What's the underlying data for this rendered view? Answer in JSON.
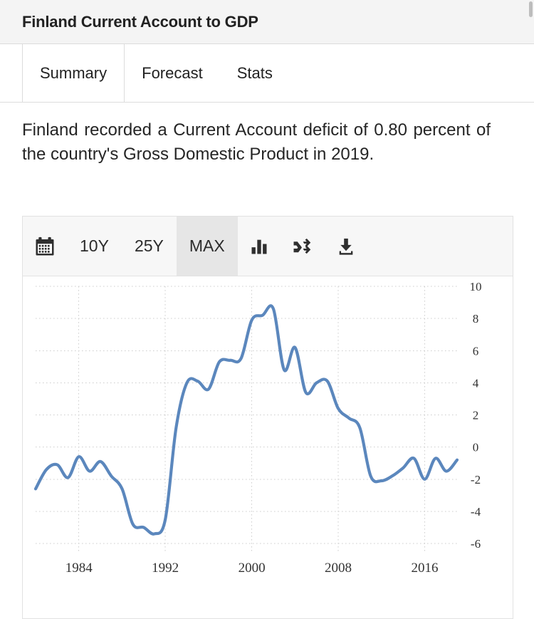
{
  "header": {
    "title": "Finland Current Account to GDP"
  },
  "tabs": [
    {
      "label": "Summary",
      "active": true
    },
    {
      "label": "Forecast",
      "active": false
    },
    {
      "label": "Stats",
      "active": false
    }
  ],
  "description": "Finland recorded a Current Account deficit of 0.80 percent of the country's Gross Domestic Product in 2019.",
  "toolbar": {
    "calendar_icon": "calendar-icon",
    "range_10y": "10Y",
    "range_25y": "25Y",
    "range_max": "MAX",
    "selected_range": "MAX",
    "column_chart_icon": "bar-chart-icon",
    "compare_icon": "shuffle-icon",
    "download_icon": "download-icon"
  },
  "colors": {
    "line": "#5b87bd",
    "grid": "#cccccc",
    "header_bg": "#f4f4f4",
    "toolbar_bg": "#f7f7f7",
    "toolbar_selected_bg": "#e6e6e6",
    "text": "#252525"
  },
  "chart_data": {
    "type": "line",
    "title": "Finland Current Account to GDP",
    "xlabel": "",
    "ylabel": "percent of GDP",
    "xlim": [
      1980,
      2019
    ],
    "ylim": [
      -6,
      10
    ],
    "ytick_values": [
      10,
      8,
      6,
      4,
      2,
      0,
      -2,
      -4,
      -6
    ],
    "xtick_values": [
      1984,
      1992,
      2000,
      2008,
      2016
    ],
    "grid": true,
    "legend": "none",
    "series": [
      {
        "name": "Current Account to GDP",
        "color": "#5b87bd",
        "x": [
          1980,
          1981,
          1982,
          1983,
          1984,
          1985,
          1986,
          1987,
          1988,
          1989,
          1990,
          1991,
          1992,
          1993,
          1994,
          1995,
          1996,
          1997,
          1998,
          1999,
          2000,
          2001,
          2002,
          2003,
          2004,
          2005,
          2006,
          2007,
          2008,
          2009,
          2010,
          2011,
          2012,
          2013,
          2014,
          2015,
          2016,
          2017,
          2018,
          2019
        ],
        "values": [
          -2.6,
          -1.4,
          -1.1,
          -1.9,
          -0.6,
          -1.5,
          -0.9,
          -1.8,
          -2.6,
          -4.8,
          -5.0,
          -5.4,
          -4.5,
          1.2,
          4.0,
          4.1,
          3.6,
          5.3,
          5.4,
          5.5,
          7.9,
          8.2,
          8.6,
          4.8,
          6.2,
          3.4,
          4.0,
          4.1,
          2.4,
          1.8,
          1.2,
          -1.8,
          -2.1,
          -1.8,
          -1.3,
          -0.7,
          -2.0,
          -0.7,
          -1.5,
          -0.8
        ]
      }
    ]
  }
}
